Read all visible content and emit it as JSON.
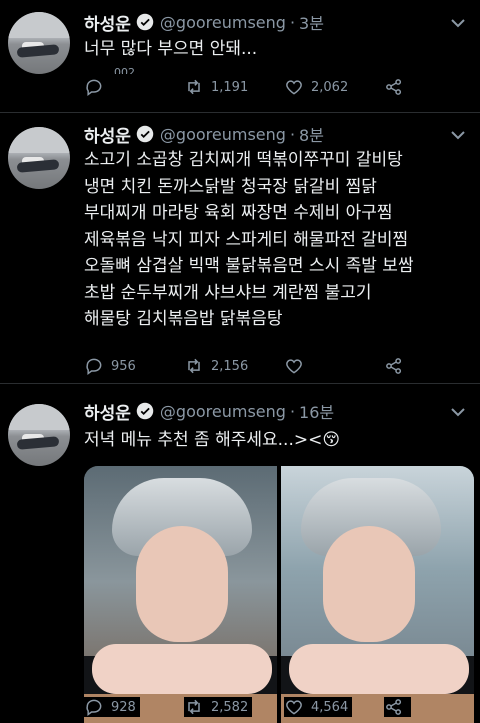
{
  "tweets": [
    {
      "name": "하성운",
      "handle": "@gooreumseng",
      "time": "3분",
      "text": "너무 많다 부으면 안돼...",
      "replies": "",
      "retweets": "1,191",
      "likes": "2,062",
      "partial_text": "002"
    },
    {
      "name": "하성운",
      "handle": "@gooreumseng",
      "time": "8분",
      "text": "소고기 소곱창 김치찌개 떡볶이쭈꾸미 갈비탕\n냉면 치킨 돈까스닭발 청국장 닭갈비 찜닭\n부대찌개 마라탕 육회 짜장면 수제비 아구찜\n제육볶음 낙지 피자 스파게티 해물파전 갈비찜\n오돌뼈 삼겹살 빅맥 불닭볶음면 스시 족발 보쌈\n초밥 순두부찌개 샤브샤브 계란찜 불고기\n해물탕 김치볶음밥 닭볶음탕",
      "replies": "956",
      "retweets": "2,156",
      "likes": ""
    },
    {
      "name": "하성운",
      "handle": "@gooreumseng",
      "time": "16분",
      "text": "저녁 메뉴 추천 좀 해주세요...><😚",
      "replies": "928",
      "retweets": "2,582",
      "likes": "4,564"
    }
  ],
  "icons": {
    "verified": "verified-badge-icon",
    "reply": "reply-icon",
    "retweet": "retweet-icon",
    "like": "heart-icon",
    "share": "share-icon",
    "more": "chevron-down-icon"
  },
  "colors": {
    "background": "#000000",
    "text": "#eceff1",
    "muted": "#8b98a5"
  }
}
